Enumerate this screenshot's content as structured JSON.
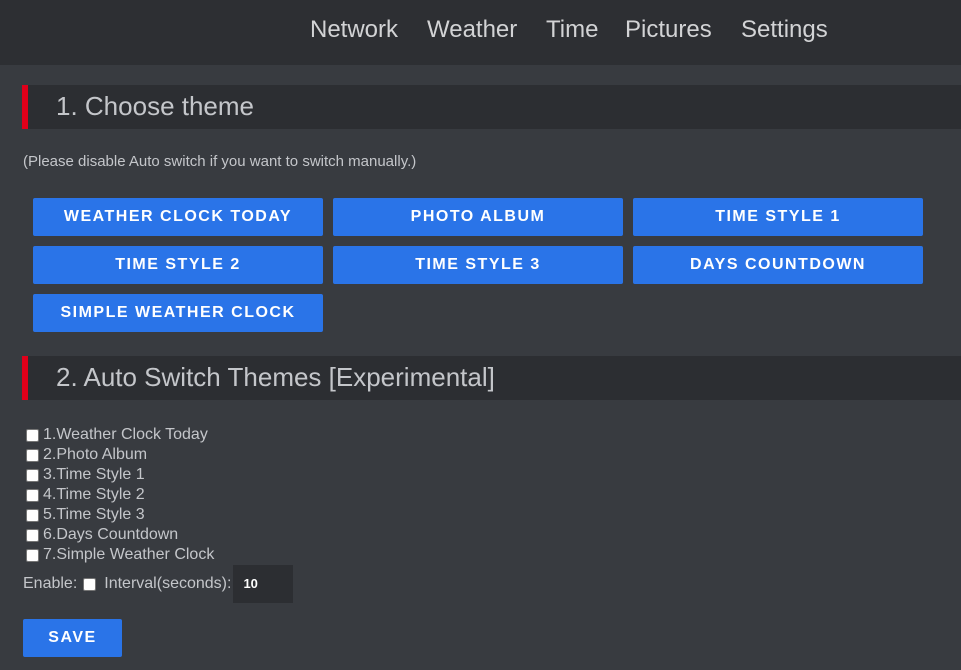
{
  "nav": {
    "items": [
      "Network",
      "Weather",
      "Time",
      "Pictures",
      "Settings"
    ]
  },
  "section1": {
    "title": "1. Choose theme",
    "note": "(Please disable Auto switch if you want to switch manually.)",
    "buttons": [
      "WEATHER CLOCK TODAY",
      "PHOTO ALBUM",
      "TIME STYLE 1",
      "TIME STYLE 2",
      "TIME STYLE 3",
      "DAYS COUNTDOWN",
      "SIMPLE WEATHER CLOCK"
    ]
  },
  "section2": {
    "title": "2. Auto Switch Themes [Experimental]",
    "themes": [
      {
        "label": "1.Weather Clock Today",
        "checked": false
      },
      {
        "label": "2.Photo Album",
        "checked": false
      },
      {
        "label": "3.Time Style 1",
        "checked": false
      },
      {
        "label": "4.Time Style 2",
        "checked": false
      },
      {
        "label": "5.Time Style 3",
        "checked": false
      },
      {
        "label": "6.Days Countdown",
        "checked": false
      },
      {
        "label": "7.Simple Weather Clock",
        "checked": false
      }
    ],
    "enable_label": "Enable:",
    "enable_checked": false,
    "interval_label": "Interval(seconds):",
    "interval_value": "10",
    "save_label": "SAVE"
  },
  "colors": {
    "background": "#383b40",
    "nav_background": "#2d2f33",
    "header_background": "#2c2e32",
    "accent_red": "#e0001a",
    "button_blue": "#2a74e8"
  }
}
